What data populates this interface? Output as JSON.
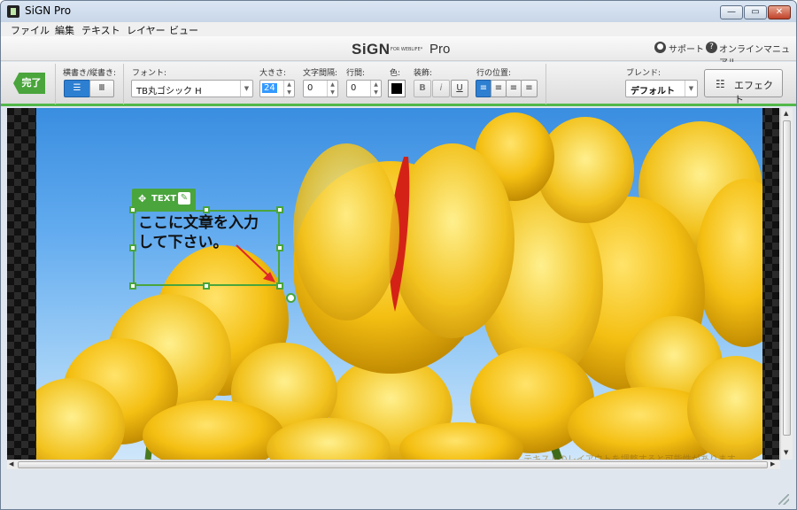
{
  "window": {
    "title": "SiGN Pro",
    "min": "—",
    "max": "▭",
    "close": "✕"
  },
  "menu": [
    "ファイル",
    "編集",
    "テキスト",
    "レイヤー",
    "ビュー"
  ],
  "header": {
    "logo": "SiGN",
    "logo_sub": "FOR WEBLIFE*",
    "logo_pro": "Pro",
    "support": "サポート",
    "manual": "オンラインマニュアル"
  },
  "toolbar": {
    "done": "完了",
    "orientation_label": "横書き/縦書き:",
    "font_label": "フォント:",
    "font_value": "TB丸ゴシック H",
    "size_label": "大きさ:",
    "size_value": "24",
    "spacing_label": "文字間隔:",
    "spacing_value": "0",
    "linespacing_label": "行間:",
    "linespacing_value": "0",
    "color_label": "色:",
    "text_color": "#000000",
    "decoration_label": "装飾:",
    "bold": "B",
    "italic": "i",
    "underline": "U",
    "align_label": "行の位置:",
    "blend_label": "ブレンド:",
    "blend_value": "デフォルト",
    "effect": "エフェクト"
  },
  "text_object": {
    "tab_label": "TEXT",
    "content": "ここに文章を入力\nして下さい。"
  },
  "canvas_hint": "テキストのレイアウトを調整すると可能性があります",
  "colors": {
    "accent": "#4aa53c",
    "arrow": "#e0262b"
  }
}
